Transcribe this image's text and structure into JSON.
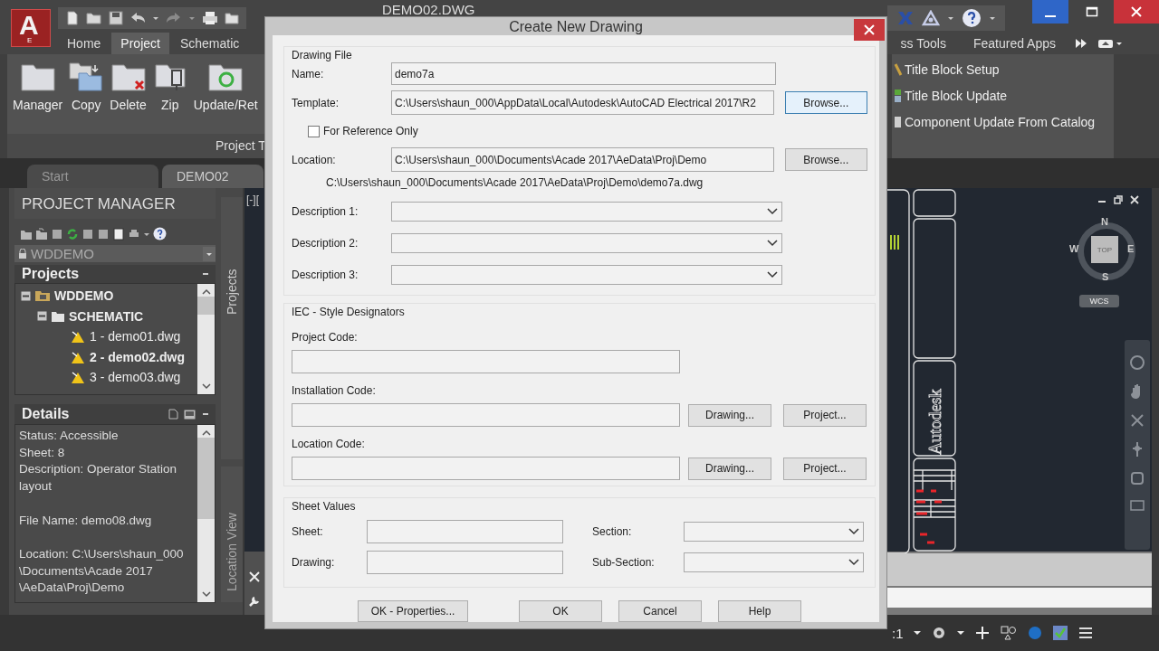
{
  "app": {
    "logo": {
      "letter": "A",
      "edition": "E"
    },
    "title": "DEMO02.DWG"
  },
  "ribbon_tabs": [
    {
      "label": "Home",
      "selected": false
    },
    {
      "label": "Project",
      "selected": true
    },
    {
      "label": "Schematic",
      "selected": false
    }
  ],
  "ribbon_tabs_right": [
    {
      "label": "ss Tools",
      "selected": false
    },
    {
      "label": "Featured Apps",
      "selected": false
    }
  ],
  "ribbon_buttons": [
    {
      "label": "Manager",
      "kind": "folder"
    },
    {
      "label": "Copy",
      "kind": "copy"
    },
    {
      "label": "Delete",
      "kind": "delete"
    },
    {
      "label": "Zip",
      "kind": "zip"
    },
    {
      "label": "Update/Ret",
      "kind": "update"
    }
  ],
  "ribbon_panel_label": "Project T",
  "ribbon_tools": [
    {
      "label": "Title Block Setup",
      "kind": "setup"
    },
    {
      "label": "Title Block Update",
      "kind": "update"
    },
    {
      "label": "Component Update From Catalog",
      "kind": "catalog"
    }
  ],
  "doc_tabs": [
    {
      "label": "Start",
      "selected": false
    },
    {
      "label": "DEMO02",
      "selected": true
    }
  ],
  "project_manager": {
    "title": "PROJECT MANAGER",
    "current_project": "WDDEMO",
    "projects_header": "Projects",
    "tree": [
      {
        "label": "WDDEMO",
        "expanded": true,
        "children": [
          {
            "label": "SCHEMATIC",
            "expanded": true,
            "children": [
              {
                "label": "1 - demo01.dwg",
                "active": false
              },
              {
                "label": "2 - demo02.dwg",
                "active": true
              },
              {
                "label": "3 - demo03.dwg",
                "active": false
              }
            ]
          }
        ]
      }
    ],
    "details_header": "Details",
    "details": [
      {
        "text": "Status: Accessible",
        "gap_before": false
      },
      {
        "text": "Sheet: 8",
        "gap_before": false
      },
      {
        "text": "Description: Operator Station layout",
        "gap_before": false
      },
      {
        "text": "File Name: demo08.dwg",
        "gap_before": true
      },
      {
        "text": "Location: C:\\Users\\shaun_000 \\Documents\\Acade 2017 \\AeData\\Proj\\Demo",
        "gap_before": true
      }
    ],
    "side_tabs": [
      {
        "label": "Projects",
        "selected": true
      },
      {
        "label": "Location View",
        "selected": false
      }
    ]
  },
  "viewport": {
    "label": "[-][",
    "viewcube": {
      "north": "N",
      "west": "W",
      "east": "E",
      "south": "S",
      "face": "TOP",
      "ucs": "WCS"
    },
    "drawing_text": "Autodesk"
  },
  "status_bar": {
    "scale": ":1"
  },
  "dialog": {
    "title": "Create New Drawing",
    "drawing_file": {
      "legend": "Drawing File",
      "name": {
        "label": "Name:",
        "value": "demo7a"
      },
      "template": {
        "label": "Template:",
        "value": "C:\\Users\\shaun_000\\AppData\\Local\\Autodesk\\AutoCAD Electrical 2017\\R2",
        "button": "Browse...",
        "focused": true
      },
      "reference": {
        "label": "For Reference Only",
        "checked": false
      },
      "location": {
        "label": "Location:",
        "value": "C:\\Users\\shaun_000\\Documents\\Acade 2017\\AeData\\Proj\\Demo",
        "button": "Browse...",
        "focused": false
      },
      "full_path": "C:\\Users\\shaun_000\\Documents\\Acade 2017\\AeData\\Proj\\Demo\\demo7a.dwg",
      "descriptions": [
        {
          "label": "Description 1:"
        },
        {
          "label": "Description 2:"
        },
        {
          "label": "Description 3:"
        }
      ]
    },
    "iec": {
      "legend": "IEC - Style Designators",
      "fields": [
        {
          "label": "Project Code:"
        },
        {
          "label": "Installation Code:",
          "buttons": [
            "Drawing...",
            "Project..."
          ]
        },
        {
          "label": "Location Code:",
          "buttons": [
            "Drawing...",
            "Project..."
          ]
        }
      ]
    },
    "sheet_values": {
      "legend": "Sheet Values",
      "fields": [
        {
          "label": "Sheet:",
          "kind": "text"
        },
        {
          "label": "Section:",
          "kind": "combo"
        },
        {
          "label": "Drawing:",
          "kind": "text"
        },
        {
          "label": "Sub-Section:",
          "kind": "combo"
        }
      ]
    },
    "buttons": [
      "OK - Properties...",
      "OK",
      "Cancel",
      "Help"
    ]
  }
}
